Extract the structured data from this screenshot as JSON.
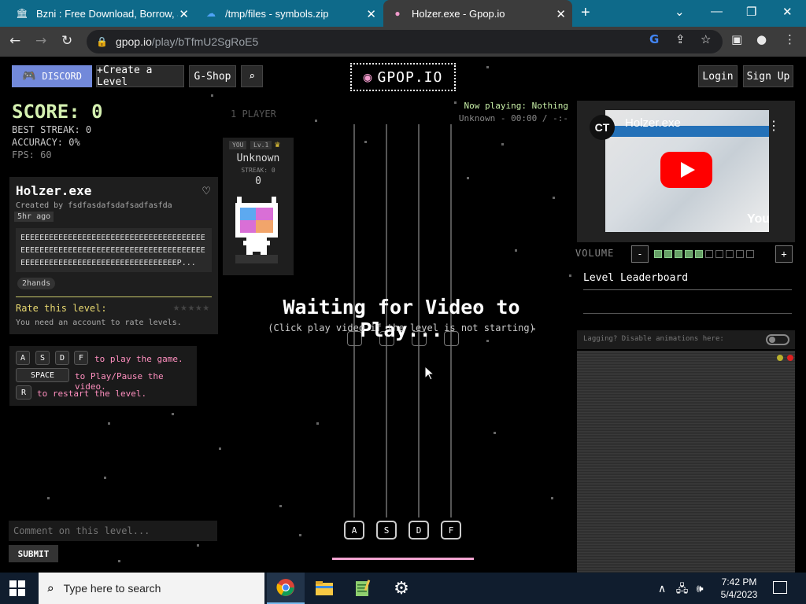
{
  "browser": {
    "tabs": [
      {
        "title": "Bzni : Free Download, Borrow, an",
        "icon": "archive-icon"
      },
      {
        "title": "/tmp/files - symbols.zip",
        "icon": "cloud-icon"
      },
      {
        "title": "Holzer.exe - Gpop.io",
        "icon": "gpop-icon",
        "active": true
      }
    ],
    "url_host": "gpop.io",
    "url_path": "/play/bTfmU2SgRoE5"
  },
  "nav": {
    "discord": "DISCORD",
    "create_level": "+Create a Level",
    "gshop": "G-Shop",
    "logo": "GPOP.IO",
    "login": "Login",
    "signup": "Sign Up"
  },
  "stats": {
    "score": "SCORE: 0",
    "best_streak": "BEST STREAK: 0",
    "accuracy": "ACCURACY: 0%",
    "fps": "FPS: 60"
  },
  "level": {
    "title": "Holzer.exe",
    "creator": "Created by fsdfasdafsdafsadfasfda",
    "time": "5hr ago",
    "description": "EEEEEEEEEEEEEEEEEEEEEEEEEEEEEEEEEEEEEEEEEEEEEEEEEEEEEEEEEEEEEEEEEEEEEEEEEEEEEEEEEEEEEEEEEEEEEEEEEEEEEEEEEEEEEEEP...",
    "tag": "2hands",
    "rate_label": "Rate this level:",
    "rate_note": "You need an account to rate levels."
  },
  "controls": {
    "keys": [
      "A",
      "S",
      "D",
      "F"
    ],
    "play_text": "to play the game.",
    "space_key": "SPACE",
    "space_text": "to Play/Pause the video.",
    "r_key": "R",
    "r_text": "to restart the level."
  },
  "comment": {
    "placeholder": "Comment on this level...",
    "submit": "SUBMIT"
  },
  "player": {
    "section_label": "1 PLAYER",
    "you": "YOU",
    "level": "Lv.1",
    "name": "Unknown",
    "streak": "STREAK: 0",
    "score": "0"
  },
  "now_playing": "Now playing: Nothing",
  "time_readout": "Unknown - 00:00 / -:-",
  "game": {
    "waiting_title": "Waiting for Video to Play...",
    "waiting_sub": "(Click play video if the level is not starting)",
    "lanes": [
      "A",
      "S",
      "D",
      "F"
    ]
  },
  "video": {
    "title": "Holzer.exe",
    "channel": "CT",
    "menu": "⋮",
    "yt": "YouTube"
  },
  "volume": {
    "label": "VOLUME",
    "minus": "-",
    "plus": "+",
    "level": 5,
    "segments": 10
  },
  "leaderboard_title": "Level Leaderboard",
  "lag_label": "Lagging? Disable animations here:",
  "taskbar": {
    "search": "Type here to search",
    "time": "7:42 PM",
    "date": "5/4/2023"
  },
  "colors": {
    "accent_green": "#d4f0b0",
    "discord": "#7289da",
    "rate_yellow": "#e8d870",
    "control_pink": "#ff8fbf",
    "progress_pink": "#f3a4d2"
  }
}
